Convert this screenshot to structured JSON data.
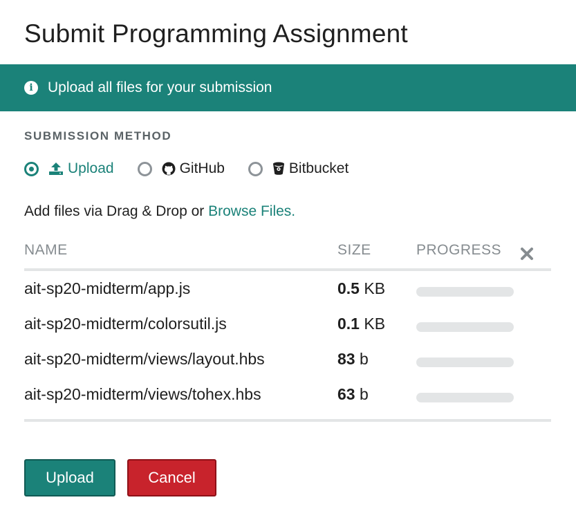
{
  "dialog": {
    "title": "Submit Programming Assignment"
  },
  "banner": {
    "icon": "info-icon",
    "text": "Upload all files for your submission",
    "color": "#1b8279"
  },
  "submission_method": {
    "label": "SUBMISSION METHOD",
    "options": [
      {
        "label": "Upload",
        "icon": "upload-icon",
        "selected": true
      },
      {
        "label": "GitHub",
        "icon": "github-icon",
        "selected": false
      },
      {
        "label": "Bitbucket",
        "icon": "bitbucket-icon",
        "selected": false
      }
    ]
  },
  "add_files": {
    "prefix": "Add files via Drag & Drop or ",
    "link": "Browse Files."
  },
  "table": {
    "headers": {
      "name": "NAME",
      "size": "SIZE",
      "progress": "PROGRESS",
      "clear_icon": "close-icon"
    },
    "rows": [
      {
        "name": "ait-sp20-midterm/app.js",
        "size_value": "0.5",
        "size_unit": "KB",
        "progress": 0
      },
      {
        "name": "ait-sp20-midterm/colorsutil.js",
        "size_value": "0.1",
        "size_unit": "KB",
        "progress": 0
      },
      {
        "name": "ait-sp20-midterm/views/layout.hbs",
        "size_value": "83",
        "size_unit": "b",
        "progress": 0
      },
      {
        "name": "ait-sp20-midterm/views/tohex.hbs",
        "size_value": "63",
        "size_unit": "b",
        "progress": 0
      }
    ]
  },
  "actions": {
    "upload_label": "Upload",
    "cancel_label": "Cancel"
  },
  "colors": {
    "accent": "#1b8279",
    "danger": "#c8232c",
    "muted": "#868c90"
  }
}
